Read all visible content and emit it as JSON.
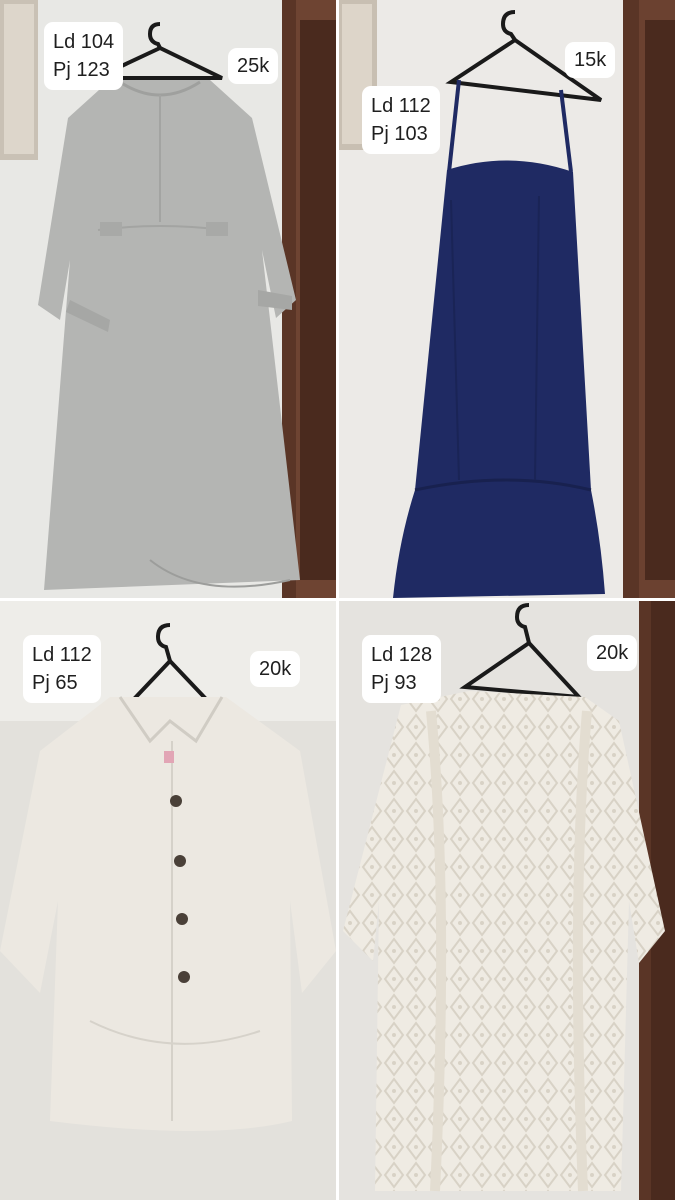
{
  "items": [
    {
      "ld": "Ld 104",
      "pj": "Pj 123",
      "price": "25k"
    },
    {
      "ld": "Ld 112",
      "pj": "Pj 103",
      "price": "15k"
    },
    {
      "ld": "Ld 112",
      "pj": "Pj 65",
      "price": "20k"
    },
    {
      "ld": "Ld 128",
      "pj": "Pj 93",
      "price": "20k"
    }
  ],
  "colors": {
    "grey_dress": "#b4b5b3",
    "navy_dress": "#1f2a63",
    "white_shirt": "#ece8e1",
    "lace_cardigan": "#efebe3",
    "wood_frame": "#5a3526",
    "hanger": "#1a1a1a"
  }
}
